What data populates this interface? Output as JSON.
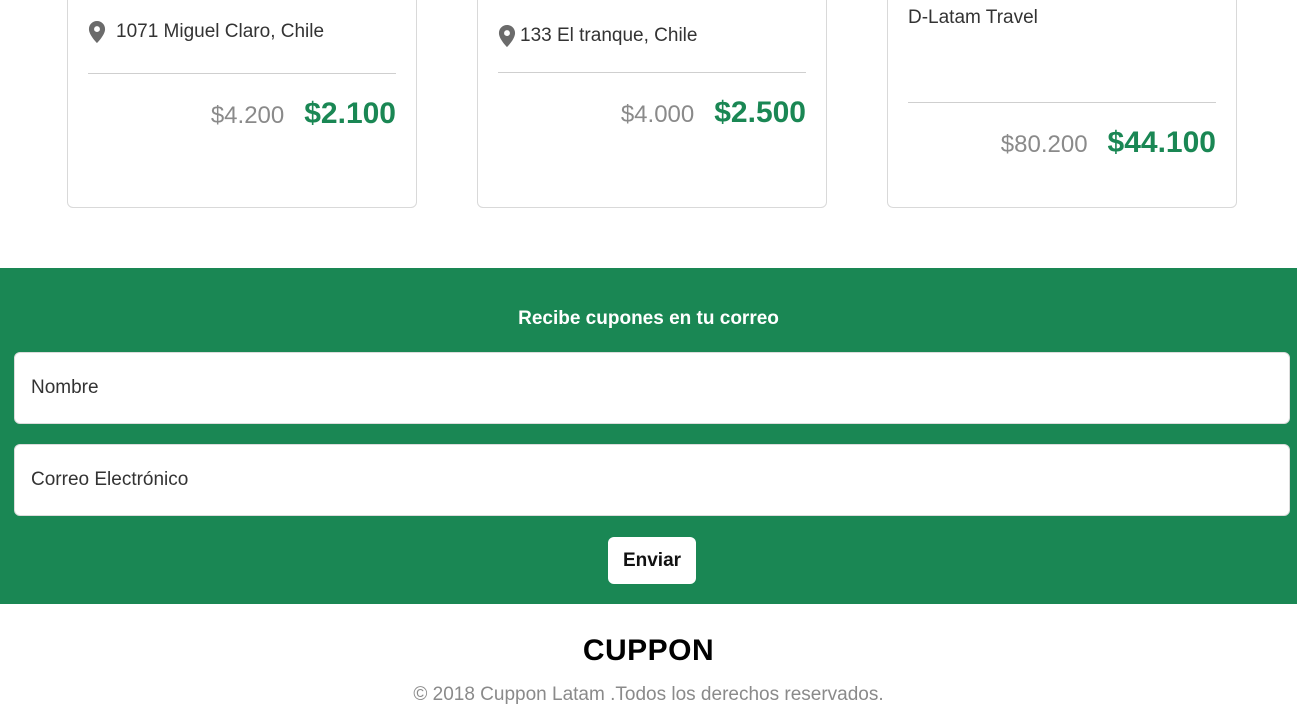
{
  "cards": [
    {
      "location": "1071 Miguel Claro, Chile",
      "old_price": "$4.200",
      "new_price": "$2.100"
    },
    {
      "location": "133 El tranque, Chile",
      "old_price": "$4.000",
      "new_price": "$2.500"
    },
    {
      "vendor": "D-Latam Travel",
      "old_price": "$80.200",
      "new_price": "$44.100"
    }
  ],
  "newsletter": {
    "title": "Recibe cupones en tu correo",
    "name_placeholder": "Nombre",
    "email_placeholder": "Correo Electrónico",
    "submit_label": "Enviar"
  },
  "footer": {
    "brand": "CUPPON",
    "copyright": "© 2018 Cuppon Latam .Todos los derechos reservados."
  },
  "colors": {
    "brand_green": "#1a8754",
    "muted_gray": "#8a8a8a"
  }
}
